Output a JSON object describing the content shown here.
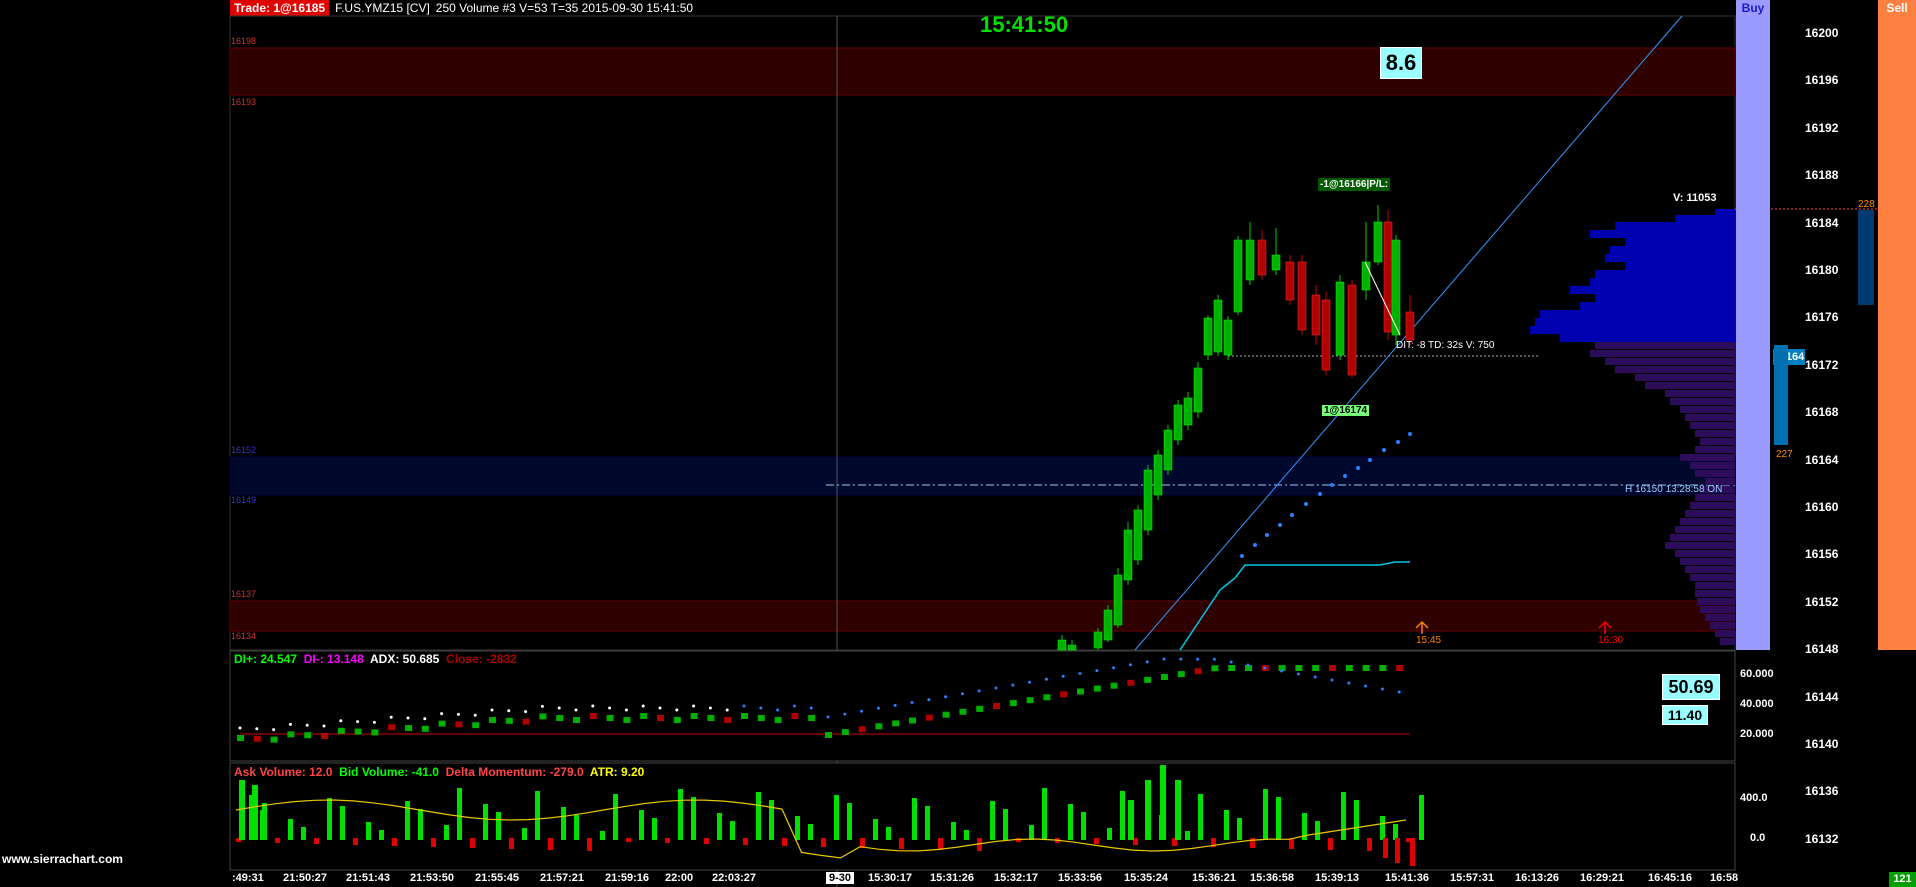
{
  "header": {
    "trade_badge": "Trade: 1@16185",
    "symbol": "F.US.YMZ15 [CV]",
    "chart_info": "250 Volume  #3 V=53 T=35 2015-09-30 15:41:50"
  },
  "clock": "15:41:50",
  "boxes": {
    "top": "8.6",
    "adx_value": "50.69",
    "atr_value": "11.40"
  },
  "buttons": {
    "buy": "Buy",
    "sell": "Sell"
  },
  "price_axis": {
    "labels": [
      "16200",
      "16196",
      "16192",
      "16188",
      "16184",
      "16180",
      "16176",
      "16172",
      "16168",
      "16164",
      "16160",
      "16156",
      "16152",
      "16148",
      "16144",
      "16140",
      "16136",
      "16132"
    ],
    "current_price": "16164",
    "tape_top": "228",
    "tape_bottom": "227"
  },
  "zone_labels": [
    "16198",
    "16193",
    "16152",
    "16149",
    "16137",
    "16134"
  ],
  "annotations": {
    "volume_total": "V: 11053",
    "position": "-1@16166|P/L:",
    "trade_stats": "DIT: -8  TD: 32s  V: 750",
    "fill_tag": "1@16174",
    "h_line": "H 16150  13:28:58  ON",
    "arrow1_time": "15:45",
    "arrow2_time": "16:30"
  },
  "adx_panel": {
    "di_plus": "DI+: 24.547",
    "di_minus": "DI-: 13.148",
    "adx": "ADX: 50.685",
    "close": "Close: -2832",
    "axis": [
      "60.000",
      "40.000",
      "20.000"
    ]
  },
  "volume_panel": {
    "ask_volume": "Ask Volume: 12.0",
    "bid_volume": "Bid Volume: -41.0",
    "delta_momentum": "Delta Momentum: -279.0",
    "atr": "ATR: 9.20",
    "axis": [
      "400.0",
      "0.0"
    ]
  },
  "x_axis": {
    "labels": [
      ":49:31",
      "21:50:27",
      "21:51:43",
      "21:53:50",
      "21:55:45",
      "21:57:21",
      "21:59:16",
      "22:00",
      "22:03:27",
      "9-30",
      "15:30:17",
      "15:31:26",
      "15:32:17",
      "15:33:56",
      "15:35:24",
      "15:36:21",
      "15:36:58",
      "15:39:13",
      "15:41:36",
      "15:57:31",
      "16:13:26",
      "16:29:21",
      "16:45:16",
      "16:58"
    ],
    "corner": "121"
  },
  "brand": "www.sierrachart.com",
  "colors": {
    "up": "#00c800",
    "down": "#c80000",
    "zone_red": "#3a0000",
    "zone_blue": "#000a3a",
    "profile": "#0000b0",
    "profile_low": "#2a0a50",
    "buy": "#9a9aff",
    "sell": "#ff8040"
  }
}
